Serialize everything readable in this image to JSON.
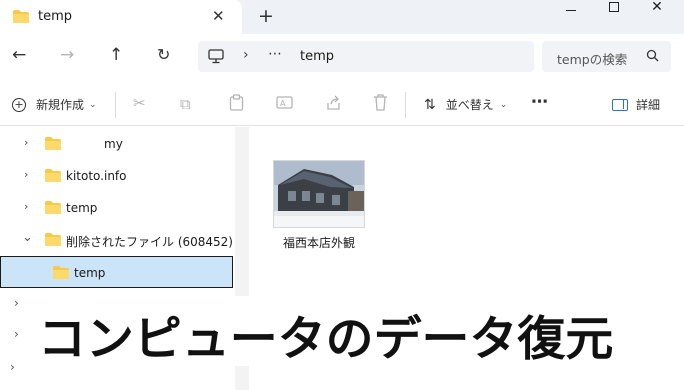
{
  "tab": {
    "title": "temp",
    "close": "✕",
    "new_tab": "+"
  },
  "window": {
    "close": "✕"
  },
  "nav": {
    "back": "←",
    "forward": "→",
    "up": "↑",
    "refresh": "↻"
  },
  "address": {
    "separator": "›",
    "more": "⋯",
    "crumb": "temp"
  },
  "search": {
    "placeholder": "tempの検索"
  },
  "toolbar": {
    "new_label": "新規作成",
    "sort_label": "並べ替え",
    "more": "⋯",
    "details_label": "詳細"
  },
  "sidebar": {
    "items": [
      {
        "label": "my",
        "chevron": "›"
      },
      {
        "label": "kitoto.info",
        "chevron": "›"
      },
      {
        "label": "temp",
        "chevron": "›"
      },
      {
        "label": "削除されたファイル (608452)",
        "chevron": "⌄"
      },
      {
        "label": "temp",
        "chevron": "",
        "selected": true
      }
    ]
  },
  "content": {
    "files": [
      {
        "name": "福西本店外観",
        "icon": "image-thumbnail"
      }
    ]
  },
  "overlay": {
    "headline": "コンピュータのデータ復元"
  },
  "colors": {
    "selection": "#cce4f7",
    "folder": "#f7c948",
    "accent": "#2b6fcf"
  }
}
